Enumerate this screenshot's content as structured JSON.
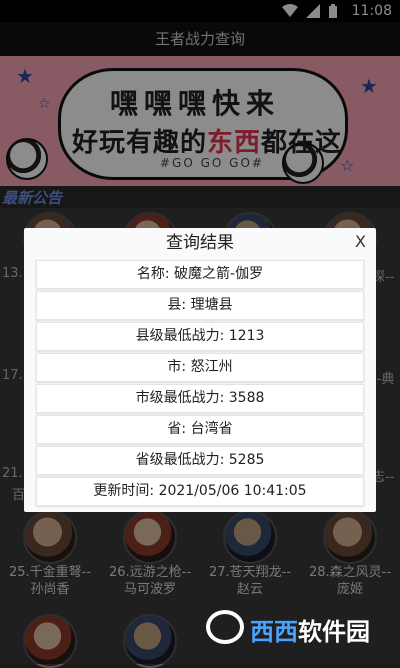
{
  "status": {
    "time": "11:08"
  },
  "appbar": {
    "title": "王者战力查询"
  },
  "banner": {
    "line1": "嘿嘿嘿快来",
    "line2_prefix": "好玩有趣的",
    "line2_highlight": "东西",
    "line2_suffix": "都在这",
    "tag": "#GO GO GO#"
  },
  "notice": {
    "label": "最新公告"
  },
  "grid": {
    "row1_left": "13.",
    "row1_right": "探--",
    "row2_left": "17.",
    "row2_right": "--典",
    "row3_left1": "21.",
    "row3_left2": "百",
    "row3_right": "志--",
    "cards": [
      {
        "name1": "25.千金重弩--",
        "name2": "孙尚香"
      },
      {
        "name1": "26.远游之枪--",
        "name2": "马可波罗"
      },
      {
        "name1": "27.苍天翔龙--",
        "name2": "赵云"
      },
      {
        "name1": "28.森之风灵--",
        "name2": "庞姬"
      }
    ]
  },
  "dialog": {
    "title": "查询结果",
    "close": "X",
    "rows": [
      "名称: 破魔之箭-伽罗",
      "县: 理塘县",
      "县级最低战力: 1213",
      "市: 怒江州",
      "市级最低战力: 3588",
      "省: 台湾省",
      "省级最低战力: 5285",
      "更新时间: 2021/05/06 10:41:05"
    ]
  },
  "watermark": {
    "text_a": "西西",
    "text_b": "软件园"
  }
}
